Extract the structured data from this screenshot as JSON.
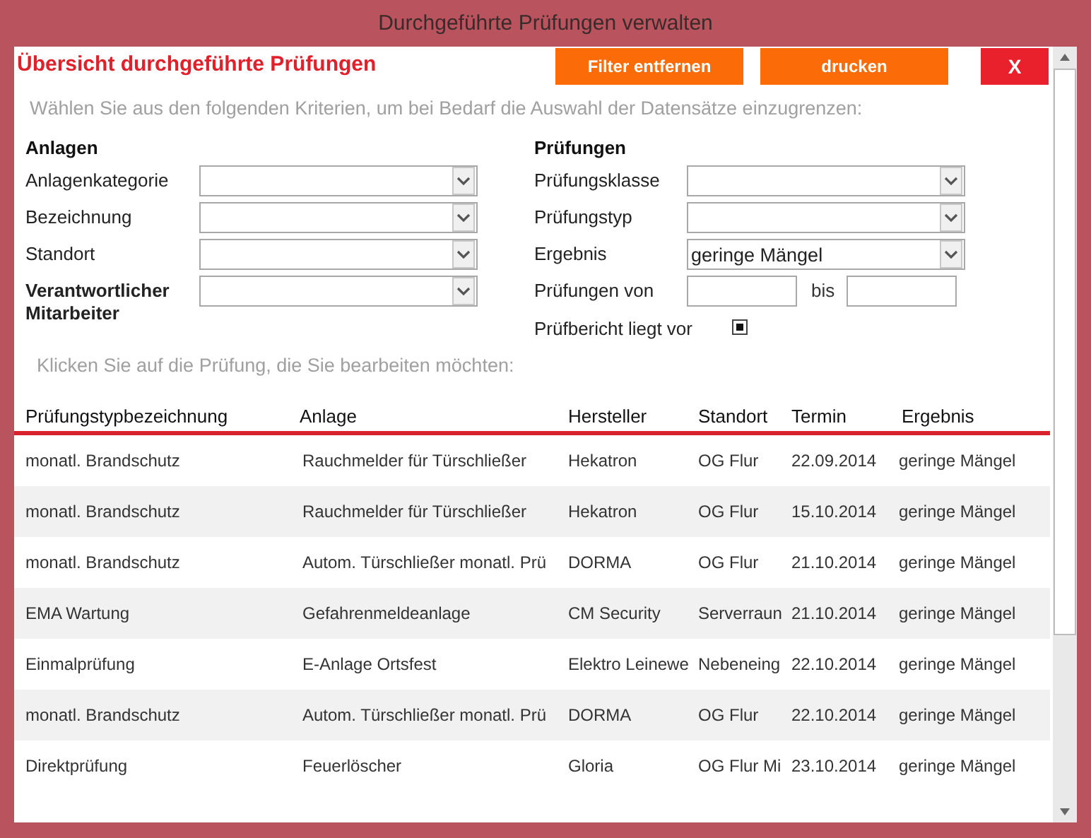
{
  "window": {
    "title": "Durchgeführte Prüfungen verwalten"
  },
  "header": {
    "title": "Übersicht durchgeführte Prüfungen",
    "buttons": [
      {
        "label": "Filter entfernen",
        "kind": "action"
      },
      {
        "label": "drucken",
        "kind": "action"
      },
      {
        "label": "X",
        "kind": "close"
      }
    ]
  },
  "filter": {
    "hint": "Wählen Sie aus den folgenden Kriterien, um bei Bedarf die Auswahl der Datensätze einzugrenzen:",
    "groups": [
      {
        "heading": "Anlagen",
        "fields": [
          {
            "kind": "combo",
            "label": "Anlagenkategorie",
            "emphasized": false
          },
          {
            "kind": "combo",
            "label": "Bezeichnung",
            "emphasized": false
          },
          {
            "kind": "combo",
            "label": "Standort",
            "emphasized": false
          },
          {
            "kind": "combo",
            "label": "Verantwortlicher Mitarbeiter",
            "emphasized": true
          }
        ]
      },
      {
        "heading": "Prüfungen",
        "fields": [
          {
            "kind": "combo",
            "label": "Prüfungsklasse",
            "emphasized": false
          },
          {
            "kind": "combo",
            "label": "Prüfungstyp",
            "emphasized": false
          },
          {
            "kind": "combo",
            "label": "Ergebnis",
            "emphasized": false,
            "value": "geringe Mängel"
          },
          {
            "kind": "range",
            "label": "Prüfungen von",
            "emphasized": false,
            "separator": "bis"
          },
          {
            "kind": "checkbox",
            "label": "Prüfbericht liegt vor",
            "emphasized": false,
            "checked": true
          }
        ]
      }
    ]
  },
  "list": {
    "hint": "Klicken Sie auf die Prüfung, die Sie bearbeiten möchten:",
    "columns": [
      "Prüfungstypbezeichnung",
      "Anlage",
      "Hersteller",
      "Standort",
      "Termin",
      "Ergebnis"
    ],
    "rows": [
      [
        "monatl. Brandschutz",
        "Rauchmelder für Türschließer",
        "Hekatron",
        "OG Flur",
        "22.09.2014",
        "geringe Mängel"
      ],
      [
        "monatl. Brandschutz",
        "Rauchmelder für Türschließer",
        "Hekatron",
        "OG Flur",
        "15.10.2014",
        "geringe Mängel"
      ],
      [
        "monatl. Brandschutz",
        "Autom. Türschließer monatl. Prü",
        "DORMA",
        "OG Flur",
        "21.10.2014",
        "geringe Mängel"
      ],
      [
        "EMA Wartung",
        "Gefahrenmeldeanlage",
        "CM Security",
        "Serverraun",
        "21.10.2014",
        "geringe Mängel"
      ],
      [
        "Einmalprüfung",
        "E-Anlage Ortsfest",
        "Elektro Leinewe",
        "Nebeneing",
        "22.10.2014",
        "geringe Mängel"
      ],
      [
        "monatl. Brandschutz",
        "Autom. Türschließer monatl. Prü",
        "DORMA",
        "OG Flur",
        "22.10.2014",
        "geringe Mängel"
      ],
      [
        "Direktprüfung",
        "Feuerlöscher",
        "Gloria",
        "OG Flur Mi",
        "23.10.2014",
        "geringe Mängel"
      ]
    ]
  }
}
